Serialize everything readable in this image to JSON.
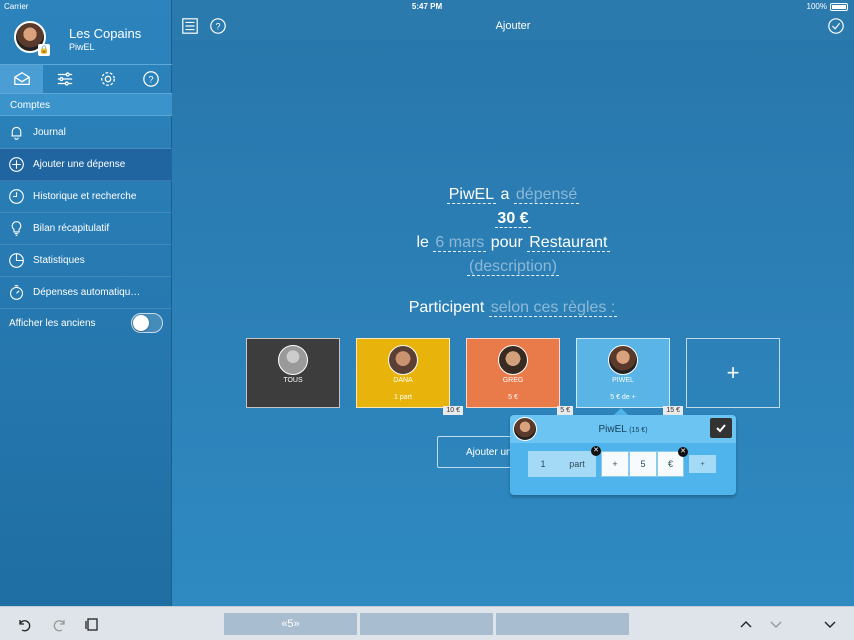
{
  "statusbar": {
    "carrier": "Carrier",
    "time": "5:47 PM",
    "battery": "100%"
  },
  "account": {
    "name": "Les Copains",
    "user": "PiwEL"
  },
  "sidebar": {
    "section": "Comptes",
    "items": [
      {
        "label": "Journal",
        "icon": "bell-icon"
      },
      {
        "label": "Ajouter une dépense",
        "icon": "plus-circle-icon"
      },
      {
        "label": "Historique et recherche",
        "icon": "clock-icon"
      },
      {
        "label": "Bilan récapitulatif",
        "icon": "lightbulb-icon"
      },
      {
        "label": "Statistiques",
        "icon": "pie-chart-icon"
      },
      {
        "label": "Dépenses automatiqu…",
        "icon": "timer-icon"
      }
    ],
    "toggle_label": "Afficher les anciens"
  },
  "header": {
    "title": "Ajouter"
  },
  "sentence": {
    "payer": "PiwEL",
    "a": "a",
    "verb": "dépensé",
    "amount": "30 €",
    "le": "le",
    "date": "6 mars",
    "pour": "pour",
    "category": "Restaurant",
    "description": "(description)",
    "participent": "Participent",
    "rules": "selon ces règles :"
  },
  "participants": [
    {
      "name": "TOUS",
      "value": "",
      "tag": ""
    },
    {
      "name": "DANA",
      "value": "1 part",
      "tag": "10 €"
    },
    {
      "name": "GREG",
      "value": "5 €",
      "tag": "5 €"
    },
    {
      "name": "PIWEL",
      "value": "5 € de +",
      "tag": "15 €"
    }
  ],
  "add_card": "+",
  "action_button": "Ajouter un",
  "popover": {
    "name": "PiwEL",
    "amount": "(15 €)",
    "parts_value": "1",
    "parts_unit": "part",
    "plus": "+",
    "extra_value": "5",
    "currency": "€",
    "small_plus": "+"
  },
  "bottom": {
    "tab_label": "«5»"
  }
}
